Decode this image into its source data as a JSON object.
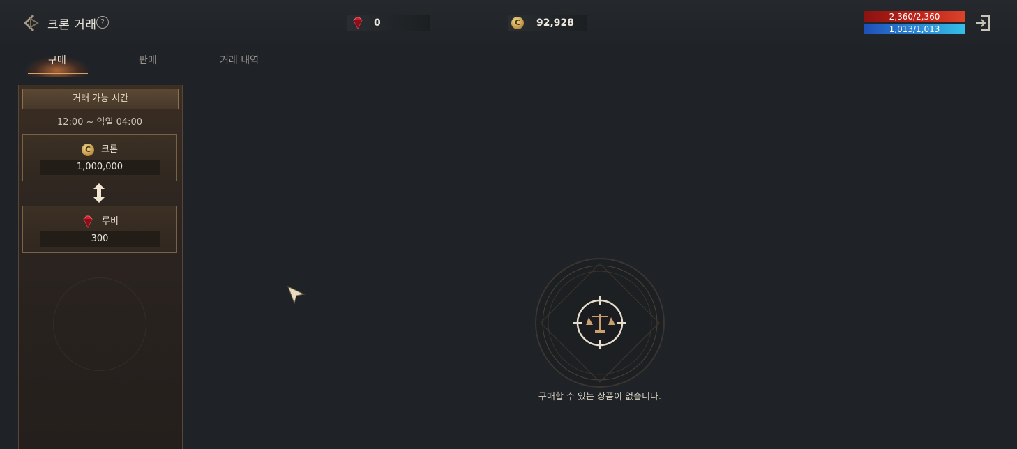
{
  "header": {
    "title": "크론 거래",
    "help_icon": "question-circle-icon",
    "help_symbol": "?",
    "ruby_icon": "ruby-gem-icon",
    "ruby_amount": "0",
    "cron_icon": "cron-coin-icon",
    "cron_symbol": "C",
    "cron_amount": "92,928",
    "hp": "2,360/2,360",
    "mp": "1,013/1,013",
    "hp_fill": 1.0,
    "mp_fill": 1.0
  },
  "tabs": [
    {
      "label": "구매",
      "active": true
    },
    {
      "label": "판매",
      "active": false
    },
    {
      "label": "거래 내역",
      "active": false
    }
  ],
  "panel": {
    "header": "거래 가능 시간",
    "time": "12:00 ~ 익일 04:00",
    "from": {
      "icon": "cron-coin-icon",
      "symbol": "C",
      "name": "크론",
      "amount": "1,000,000"
    },
    "to": {
      "icon": "ruby-gem-icon",
      "name": "루비",
      "amount": "300"
    },
    "swap_icon": "up-down-arrow-icon"
  },
  "empty_state": {
    "icon": "balance-scale-icon",
    "message": "구매할 수 있는 상품이 없습니다."
  },
  "colors": {
    "background": "#1f2226",
    "accent": "#d9a066",
    "hp": "#c5241a",
    "mp": "#2e8fd8"
  }
}
